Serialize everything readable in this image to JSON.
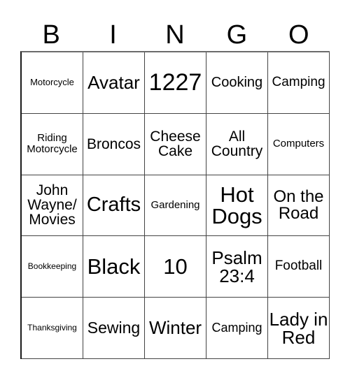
{
  "header": [
    "B",
    "I",
    "N",
    "G",
    "O"
  ],
  "cells": [
    [
      "Motorcycle",
      "Avatar",
      "1227",
      "Cooking",
      "Camping"
    ],
    [
      "Riding Motorcycle",
      "Broncos",
      "Cheese Cake",
      "All Country",
      "Computers"
    ],
    [
      "John Wayne/ Movies",
      "Crafts",
      "Gardening",
      "Hot Dogs",
      "On the Road"
    ],
    [
      "Bookkeeping",
      "Black",
      "10",
      "Psalm 23:4",
      "Football"
    ],
    [
      "Thanksgiving",
      "Sewing",
      "Winter",
      "Camping",
      "Lady in Red"
    ]
  ]
}
